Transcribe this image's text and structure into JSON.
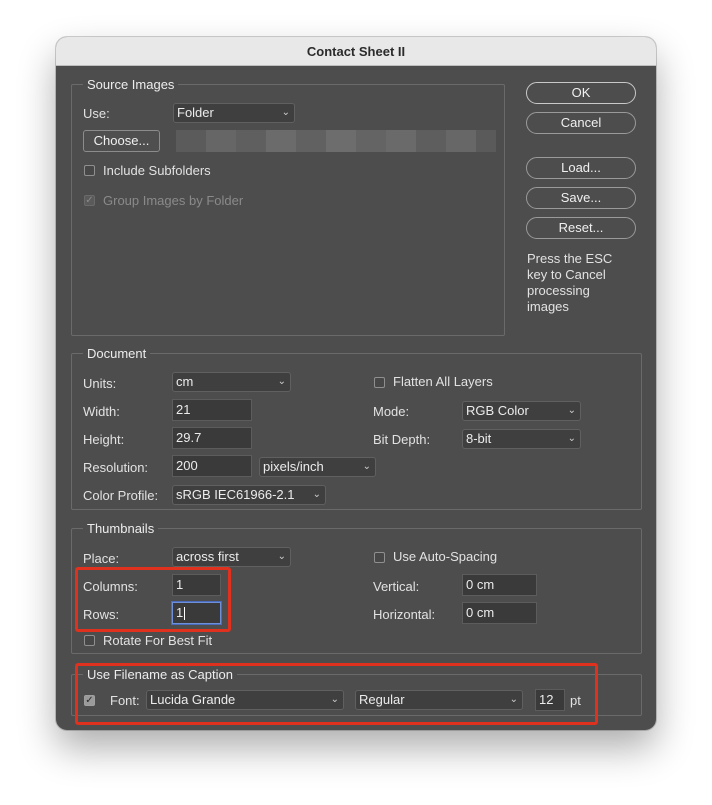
{
  "window": {
    "title": "Contact Sheet II"
  },
  "buttons": {
    "ok": "OK",
    "cancel": "Cancel",
    "load": "Load...",
    "save": "Save...",
    "reset": "Reset..."
  },
  "esc_note": [
    "Press the ESC",
    "key to Cancel",
    "processing",
    "images"
  ],
  "source": {
    "legend": "Source Images",
    "use_label": "Use:",
    "use_value": "Folder",
    "choose_label": "Choose...",
    "include_subfolders": "Include Subfolders",
    "group_images": "Group Images by Folder"
  },
  "document": {
    "legend": "Document",
    "units_label": "Units:",
    "units_value": "cm",
    "width_label": "Width:",
    "width_value": "21",
    "height_label": "Height:",
    "height_value": "29.7",
    "resolution_label": "Resolution:",
    "resolution_value": "200",
    "resolution_unit": "pixels/inch",
    "color_profile_label": "Color Profile:",
    "color_profile_value": "sRGB IEC61966-2.1",
    "flatten_label": "Flatten All Layers",
    "mode_label": "Mode:",
    "mode_value": "RGB Color",
    "bitdepth_label": "Bit Depth:",
    "bitdepth_value": "8-bit"
  },
  "thumbnails": {
    "legend": "Thumbnails",
    "place_label": "Place:",
    "place_value": "across first",
    "columns_label": "Columns:",
    "columns_value": "1",
    "rows_label": "Rows:",
    "rows_value": "1",
    "rotate_label": "Rotate For Best Fit",
    "auto_spacing_label": "Use Auto-Spacing",
    "vertical_label": "Vertical:",
    "vertical_value": "0 cm",
    "horizontal_label": "Horizontal:",
    "horizontal_value": "0 cm"
  },
  "caption": {
    "legend": "Use Filename as Caption",
    "font_label": "Font:",
    "font_value": "Lucida Grande",
    "style_value": "Regular",
    "size_value": "12",
    "size_unit": "pt"
  },
  "icons": {
    "dropdown": "chevron-down-icon",
    "check": "checkmark-icon"
  },
  "colors": {
    "dialog_bg": "#4d4d4d",
    "highlight": "#e0301e",
    "focus_ring": "#4a6bbd"
  }
}
